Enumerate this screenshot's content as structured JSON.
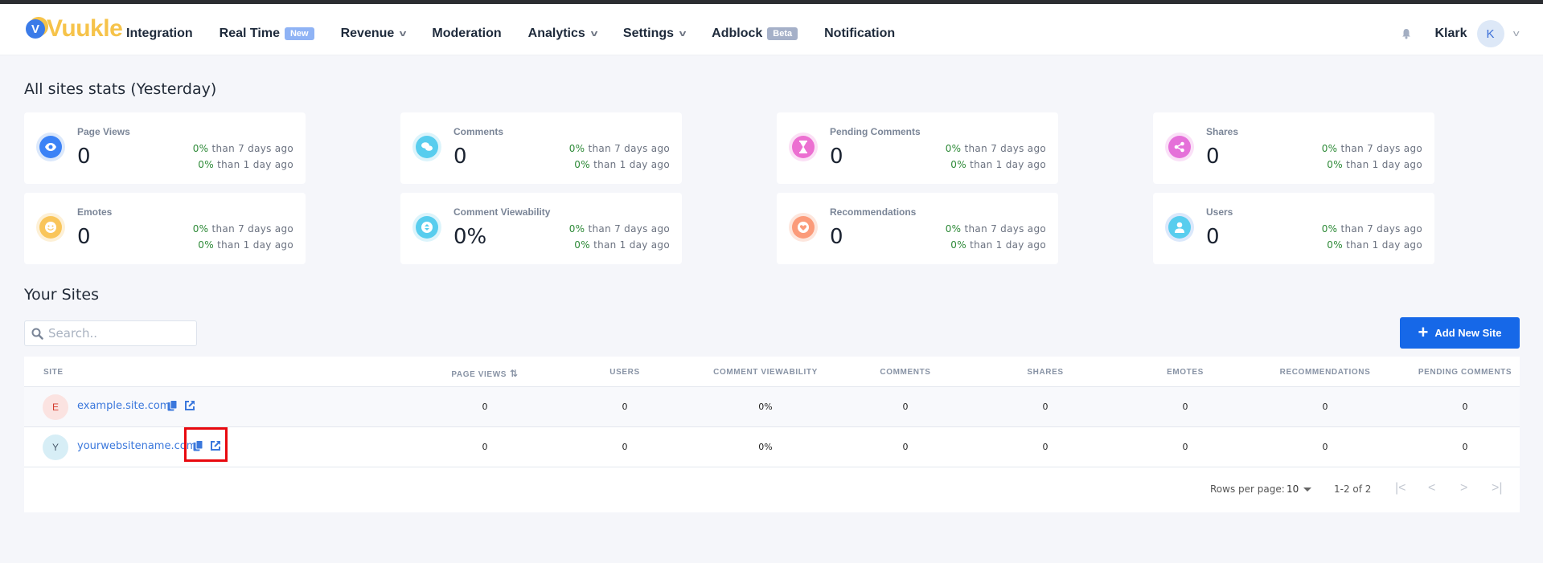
{
  "nav": {
    "logo_text": "Vuukle",
    "logo_badge": "V",
    "items": [
      {
        "label": "Integration"
      },
      {
        "label": "Real Time",
        "badge": "New"
      },
      {
        "label": "Revenue",
        "dropdown": true
      },
      {
        "label": "Moderation"
      },
      {
        "label": "Analytics",
        "dropdown": true
      },
      {
        "label": "Settings",
        "dropdown": true
      },
      {
        "label": "Adblock",
        "badge": "Beta"
      },
      {
        "label": "Notification"
      }
    ],
    "user": {
      "name": "Klark",
      "initial": "K"
    }
  },
  "stats": {
    "title": "All sites stats (Yesterday)",
    "cards": [
      {
        "label": "Page Views",
        "value": "0",
        "icon": "eye-icon",
        "pct7": "0%",
        "txt7": "than 7 days ago",
        "pct1": "0%",
        "txt1": "than 1 day ago",
        "color": "#3b82f6",
        "ring": "#dbe8fb"
      },
      {
        "label": "Comments",
        "value": "0",
        "icon": "chat-bubbles-icon",
        "pct7": "0%",
        "txt7": "than 7 days ago",
        "pct1": "0%",
        "txt1": "than 1 day ago",
        "color": "#58cdee",
        "ring": "#dcf4fb"
      },
      {
        "label": "Pending Comments",
        "value": "0",
        "icon": "hourglass-icon",
        "pct7": "0%",
        "txt7": "than 7 days ago",
        "pct1": "0%",
        "txt1": "than 1 day ago",
        "color": "#ec6fd1",
        "ring": "#fbe0f5"
      },
      {
        "label": "Shares",
        "value": "0",
        "icon": "share-icon",
        "pct7": "0%",
        "txt7": "than 7 days ago",
        "pct1": "0%",
        "txt1": "than 1 day ago",
        "color": "#e570d9",
        "ring": "#fae0f7"
      },
      {
        "label": "Emotes",
        "value": "0",
        "icon": "smiley-icon",
        "pct7": "0%",
        "txt7": "than 7 days ago",
        "pct1": "0%",
        "txt1": "than 1 day ago",
        "color": "#f9c55a",
        "ring": "#fdf0d6"
      },
      {
        "label": "Comment Viewability",
        "value": "0%",
        "icon": "scroll-arrows-icon",
        "pct7": "0%",
        "txt7": "than 7 days ago",
        "pct1": "0%",
        "txt1": "than 1 day ago",
        "color": "#58cdee",
        "ring": "#dcf4fb"
      },
      {
        "label": "Recommendations",
        "value": "0",
        "icon": "heart-icon",
        "pct7": "0%",
        "txt7": "than 7 days ago",
        "pct1": "0%",
        "txt1": "than 1 day ago",
        "color": "#fb9b7a",
        "ring": "#fde6dd"
      },
      {
        "label": "Users",
        "value": "0",
        "icon": "user-icon",
        "pct7": "0%",
        "txt7": "than 7 days ago",
        "pct1": "0%",
        "txt1": "than 1 day ago",
        "color": "#58cdee",
        "ring": "#dbe8fb"
      }
    ]
  },
  "sites": {
    "title": "Your Sites",
    "search_placeholder": "Search..",
    "add_button": "Add New Site",
    "columns": [
      "Site",
      "Page Views",
      "Users",
      "Comment Viewability",
      "Comments",
      "Shares",
      "Emotes",
      "Recommendations",
      "Pending Comments"
    ],
    "rows": [
      {
        "initial": "E",
        "site": "example.site.com",
        "avatar_bg": "#fbe3e1",
        "avatar_fg": "#d33a2c",
        "values": [
          "0",
          "0",
          "0%",
          "0",
          "0",
          "0",
          "0",
          "0"
        ]
      },
      {
        "initial": "Y",
        "site": "yourwebsitename.com",
        "avatar_bg": "#d7eef6",
        "avatar_fg": "#4a5a6b",
        "values": [
          "0",
          "0",
          "0%",
          "0",
          "0",
          "0",
          "0",
          "0"
        ]
      }
    ],
    "pagination": {
      "rows_per_page_label": "Rows per page:",
      "rows_per_page": "10",
      "range": "1-2 of 2"
    }
  },
  "colors": {
    "accent": "#1668e8",
    "link": "#3b78dc",
    "positive": "#2e8a38",
    "highlight": "#e8090f"
  }
}
